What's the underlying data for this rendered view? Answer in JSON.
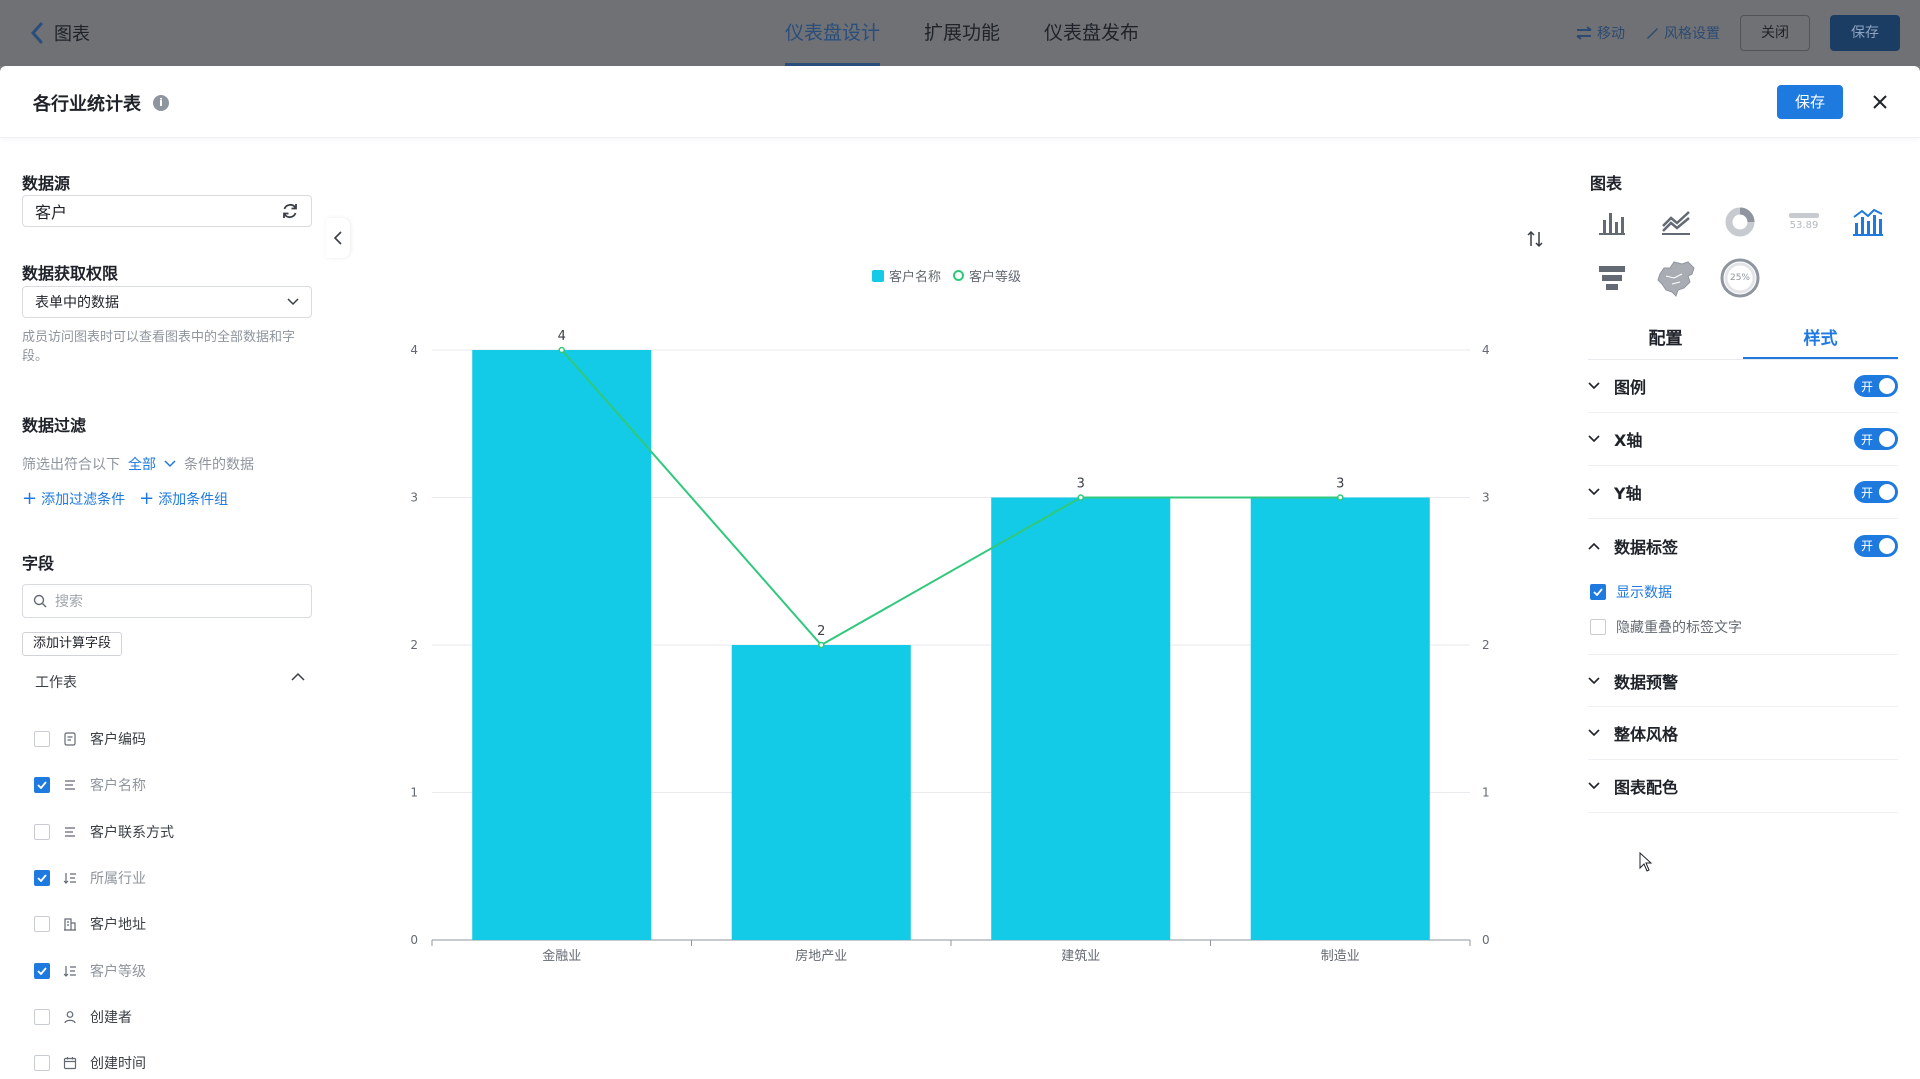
{
  "topbar": {
    "back_label": "图表",
    "tabs": [
      "仪表盘设计",
      "扩展功能",
      "仪表盘发布"
    ],
    "move_label": "移动",
    "style_label": "风格设置",
    "close_label": "关闭",
    "save_label": "保存"
  },
  "modal": {
    "title": "各行业统计表",
    "save_label": "保存"
  },
  "left": {
    "datasource_title": "数据源",
    "datasource_value": "客户",
    "permission_title": "数据获取权限",
    "permission_value": "表单中的数据",
    "permission_hint": "成员访问图表时可以查看图表中的全部数据和字段。",
    "filter_title": "数据过滤",
    "filter_prefix": "筛选出符合以下",
    "filter_mode": "全部",
    "filter_suffix": "条件的数据",
    "add_filter": "添加过滤条件",
    "add_group": "添加条件组",
    "fields_title": "字段",
    "search_placeholder": "搜索",
    "calc_field": "添加计算字段",
    "sheet_label": "工作表",
    "fields": [
      {
        "name": "客户编码",
        "checked": false,
        "icon": "doc-icon"
      },
      {
        "name": "客户名称",
        "checked": true,
        "icon": "text-icon"
      },
      {
        "name": "客户联系方式",
        "checked": false,
        "icon": "text-icon"
      },
      {
        "name": "所属行业",
        "checked": true,
        "icon": "sort-list-icon"
      },
      {
        "name": "客户地址",
        "checked": false,
        "icon": "building-icon"
      },
      {
        "name": "客户等级",
        "checked": true,
        "icon": "sort-list-icon"
      },
      {
        "name": "创建者",
        "checked": false,
        "icon": "user-icon"
      },
      {
        "name": "创建时间",
        "checked": false,
        "icon": "calendar-icon"
      }
    ]
  },
  "chart_data": {
    "type": "bar",
    "categories": [
      "金融业",
      "房地产业",
      "建筑业",
      "制造业"
    ],
    "series": [
      {
        "name": "客户名称",
        "type": "bar",
        "values": [
          4,
          2,
          3,
          3
        ],
        "color": "#13cbe6"
      },
      {
        "name": "客户等级",
        "type": "line",
        "values": [
          4,
          2,
          3,
          3
        ],
        "color": "#30c97c"
      }
    ],
    "ylim": [
      0,
      4
    ],
    "yticks": [
      "0",
      "1",
      "2",
      "3",
      "4"
    ],
    "y2ticks": [
      "0",
      "1",
      "2",
      "3",
      "4"
    ],
    "data_labels": [
      "4",
      "2",
      "3",
      "3"
    ],
    "grid": true,
    "legend": "top-center"
  },
  "right": {
    "chart_title": "图表",
    "kpi_sample": "53.89",
    "gauge_sample": "25%",
    "tabs": [
      "配置",
      "样式"
    ],
    "options": [
      {
        "label": "图例",
        "toggle": "开"
      },
      {
        "label": "X轴",
        "toggle": "开"
      },
      {
        "label": "Y轴",
        "toggle": "开"
      },
      {
        "label": "数据标签",
        "toggle": "开"
      }
    ],
    "show_data": "显示数据",
    "hide_overlap": "隐藏重叠的标签文字",
    "collapsed": [
      "数据预警",
      "整体风格",
      "图表配色"
    ]
  },
  "colors": {
    "accent": "#1f7ae0",
    "bar": "#13cbe6",
    "line": "#30c97c"
  }
}
